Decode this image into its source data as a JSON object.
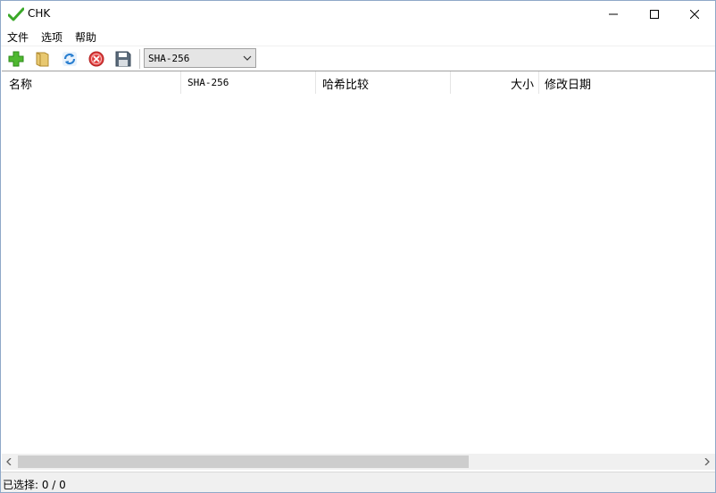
{
  "window": {
    "title": "CHK"
  },
  "menu": {
    "file": "文件",
    "options": "选项",
    "help": "帮助"
  },
  "toolbar": {
    "buttons": [
      {
        "icon": "add-icon"
      },
      {
        "icon": "folder-icon"
      },
      {
        "icon": "refresh-icon"
      },
      {
        "icon": "stop-icon"
      },
      {
        "icon": "save-icon"
      }
    ],
    "algorithm": "SHA-256"
  },
  "table": {
    "columns": [
      "名称",
      "SHA-256",
      "哈希比较",
      "大小",
      "修改日期"
    ],
    "rows": []
  },
  "status": {
    "selection": "已选择: 0 / 0"
  },
  "colors": {
    "accent_green": "#3aa828",
    "close_red": "#e04040",
    "refresh_blue": "#2a7fd0"
  }
}
